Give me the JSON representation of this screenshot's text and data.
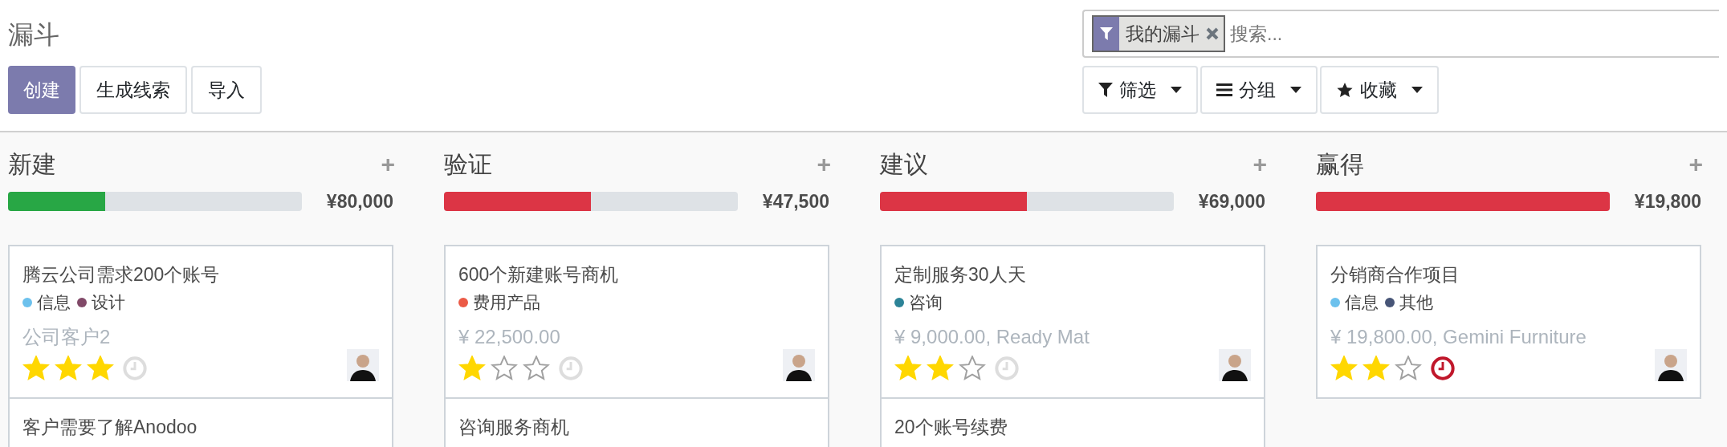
{
  "breadcrumb": "漏斗",
  "buttons": [
    {
      "label": "创建",
      "kind": "primary"
    },
    {
      "label": "生成线索",
      "kind": "secondary"
    },
    {
      "label": "导入",
      "kind": "secondary"
    }
  ],
  "search": {
    "facets": [
      {
        "label": "我的漏斗"
      }
    ],
    "placeholder": "搜索..."
  },
  "search_buttons": [
    {
      "label": "筛选",
      "kind": "filter"
    },
    {
      "label": "分组",
      "kind": "group"
    },
    {
      "label": "收藏",
      "kind": "favorite"
    }
  ],
  "columns": [
    {
      "title": "新建",
      "add": "+",
      "level": 0.33,
      "color": "#28a745",
      "total": "¥80,000",
      "cards": [
        {
          "title": "腾云公司需求200个账号",
          "tags": [
            {
              "label": "信息",
              "color": "#6cc1ed"
            },
            {
              "label": "设计",
              "color": "#814968"
            }
          ],
          "subtitle": "公司客户2",
          "stars": 3,
          "activity_overdue": false
        },
        {
          "title": "客户需要了解Anodoo"
        }
      ]
    },
    {
      "title": "验证",
      "add": "+",
      "level": 0.5,
      "color": "#dc3545",
      "total": "¥47,500",
      "cards": [
        {
          "title": "600个新建账号商机",
          "tags": [
            {
              "label": "费用产品",
              "color": "#eb5a46"
            }
          ],
          "subtitle": "¥ 22,500.00",
          "stars": 1,
          "activity_overdue": false
        },
        {
          "title": "咨询服务商机"
        }
      ]
    },
    {
      "title": "建议",
      "add": "+",
      "level": 0.5,
      "color": "#dc3545",
      "total": "¥69,000",
      "cards": [
        {
          "title": "定制服务30人天",
          "tags": [
            {
              "label": "咨询",
              "color": "#2c8397"
            }
          ],
          "subtitle": "¥ 9,000.00, Ready Mat",
          "stars": 2,
          "activity_overdue": false
        },
        {
          "title": "20个账号续费"
        }
      ]
    },
    {
      "title": "赢得",
      "add": "+",
      "level": 1,
      "color": "#dc3545",
      "total": "¥19,800",
      "cards": [
        {
          "title": "分销商合作项目",
          "tags": [
            {
              "label": "信息",
              "color": "#6cc1ed"
            },
            {
              "label": "其他",
              "color": "#475577"
            }
          ],
          "subtitle": "¥ 19,800.00, Gemini Furniture",
          "stars": 2,
          "activity_overdue": true
        }
      ]
    }
  ]
}
